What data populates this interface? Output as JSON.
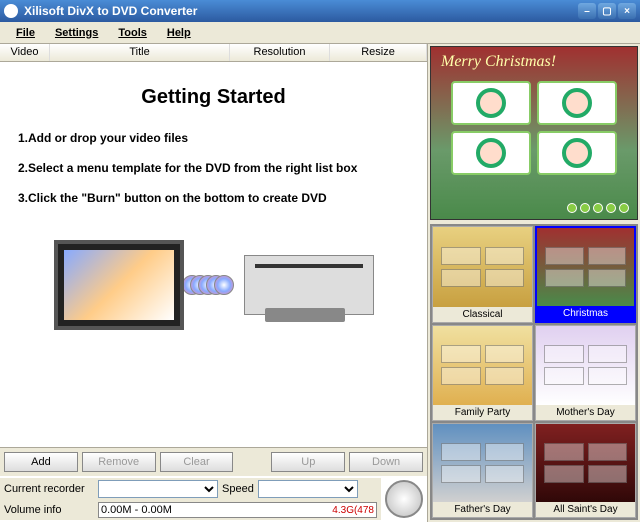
{
  "window": {
    "title": "Xilisoft DivX to DVD Converter"
  },
  "menu": {
    "file": "File",
    "settings": "Settings",
    "tools": "Tools",
    "help": "Help"
  },
  "columns": {
    "video": "Video",
    "title": "Title",
    "resolution": "Resolution",
    "resize": "Resize"
  },
  "gettingStarted": {
    "title": "Getting Started",
    "step1": "1.Add or drop your video files",
    "step2": "2.Select a menu template for the DVD from the right list box",
    "step3": "3.Click the \"Burn\" button on the bottom to create DVD"
  },
  "buttons": {
    "add": "Add",
    "remove": "Remove",
    "clear": "Clear",
    "up": "Up",
    "down": "Down"
  },
  "labels": {
    "currentRecorder": "Current recorder",
    "speed": "Speed",
    "volumeInfo": "Volume info"
  },
  "volume": {
    "used": "0.00M - 0.00M",
    "total": "4.3G(478"
  },
  "preview": {
    "title": "Merry Christmas!"
  },
  "templates": {
    "classical": "Classical",
    "christmas": "Christmas",
    "familyParty": "Family Party",
    "mothersDay": "Mother's Day",
    "fathersDay": "Father's Day",
    "allSaintsDay": "All Saint's Day"
  }
}
